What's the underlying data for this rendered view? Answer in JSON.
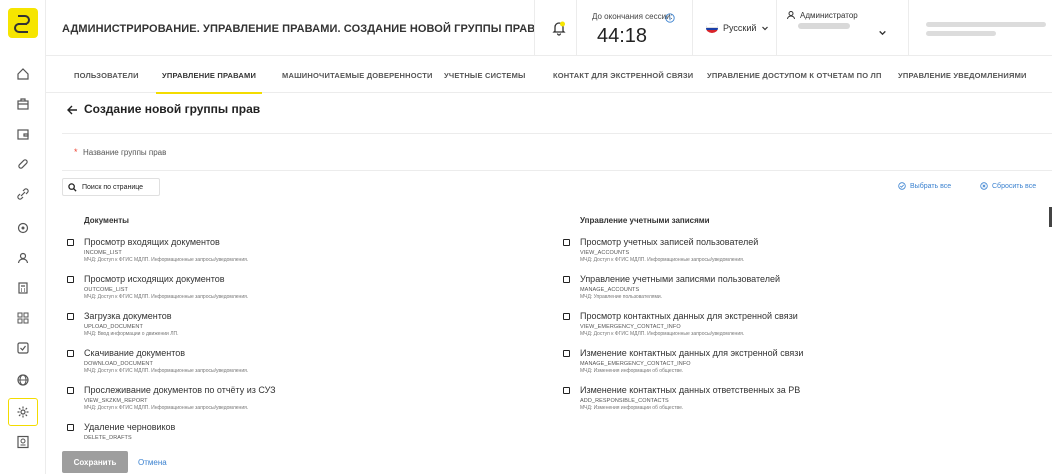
{
  "header": {
    "title": "АДМИНИСТРИРОВАНИЕ. УПРАВЛЕНИЕ ПРАВАМИ. СОЗДАНИЕ НОВОЙ ГРУППЫ ПРАВ",
    "session_label": "До окончания сессии:",
    "session_timer": "44:18",
    "language": "Русский",
    "user_role": "Администратор"
  },
  "tabs": [
    {
      "label": "ПОЛЬЗОВАТЕЛИ"
    },
    {
      "label": "УПРАВЛЕНИЕ ПРАВАМИ"
    },
    {
      "label": "МАШИНОЧИТАЕМЫЕ ДОВЕРЕННОСТИ"
    },
    {
      "label": "УЧЕТНЫЕ СИСТЕМЫ"
    },
    {
      "label": "КОНТАКТ ДЛЯ ЭКСТРЕННОЙ СВЯЗИ"
    },
    {
      "label": "УПРАВЛЕНИЕ ДОСТУПОМ К ОТЧЕТАМ ПО ЛП"
    },
    {
      "label": "УПРАВЛЕНИЕ УВЕДОМЛЕНИЯМИ"
    }
  ],
  "active_tab": "УПРАВЛЕНИЕ ПРАВАМИ",
  "content": {
    "title": "Создание новой группы прав",
    "name_placeholder": "Название группы прав",
    "search_label": "Поиск по странице",
    "select_all": "Выбрать все",
    "reset_all": "Сбросить все"
  },
  "columns": [
    {
      "title": "Документы",
      "items": [
        {
          "name": "Просмотр входящих документов",
          "code": "INCOME_LIST",
          "desc": "МЧД: Доступ к ФГИС МДЛП. Информационные запросы/уведомления."
        },
        {
          "name": "Просмотр исходящих документов",
          "code": "OUTCOME_LIST",
          "desc": "МЧД: Доступ к ФГИС МДЛП. Информационные запросы/уведомления."
        },
        {
          "name": "Загрузка документов",
          "code": "UPLOAD_DOCUMENT",
          "desc": "МЧД: Ввод информации о движении ЛП."
        },
        {
          "name": "Скачивание документов",
          "code": "DOWNLOAD_DOCUMENT",
          "desc": "МЧД: Доступ к ФГИС МДЛП. Информационные запросы/уведомления."
        },
        {
          "name": "Прослеживание документов по отчёту из СУЗ",
          "code": "VIEW_SKZKM_REPORT",
          "desc": "МЧД: Доступ к ФГИС МДЛП. Информационные запросы/уведомления."
        },
        {
          "name": "Удаление черновиков",
          "code": "DELETE_DRAFTS",
          "desc": ""
        }
      ]
    },
    {
      "title": "Управление учетными записями",
      "items": [
        {
          "name": "Просмотр учетных записей пользователей",
          "code": "VIEW_ACCOUNTS",
          "desc": "МЧД: Доступ к ФГИС МДЛП. Информационные запросы/уведомления."
        },
        {
          "name": "Управление учетными записями пользователей",
          "code": "MANAGE_ACCOUNTS",
          "desc": "МЧД: Управление пользователями."
        },
        {
          "name": "Просмотр контактных данных для экстренной связи",
          "code": "VIEW_EMERGENCY_CONTACT_INFO",
          "desc": "МЧД: Доступ к ФГИС МДЛП. Информационные запросы/уведомления."
        },
        {
          "name": "Изменение контактных данных для экстренной связи",
          "code": "MANAGE_EMERGENCY_CONTACT_INFO",
          "desc": "МЧД: Изменения информации об обществе."
        },
        {
          "name": "Изменение контактных данных ответственных за РВ",
          "code": "ADD_RESPONSIBLE_CONTACTS",
          "desc": "МЧД: Изменения информации об обществе."
        }
      ]
    }
  ],
  "footer": {
    "save": "Сохранить",
    "cancel": "Отмена"
  },
  "colors": {
    "accent": "#f6e500",
    "link": "#3b82d0",
    "save_disabled": "#9e9e9e"
  }
}
